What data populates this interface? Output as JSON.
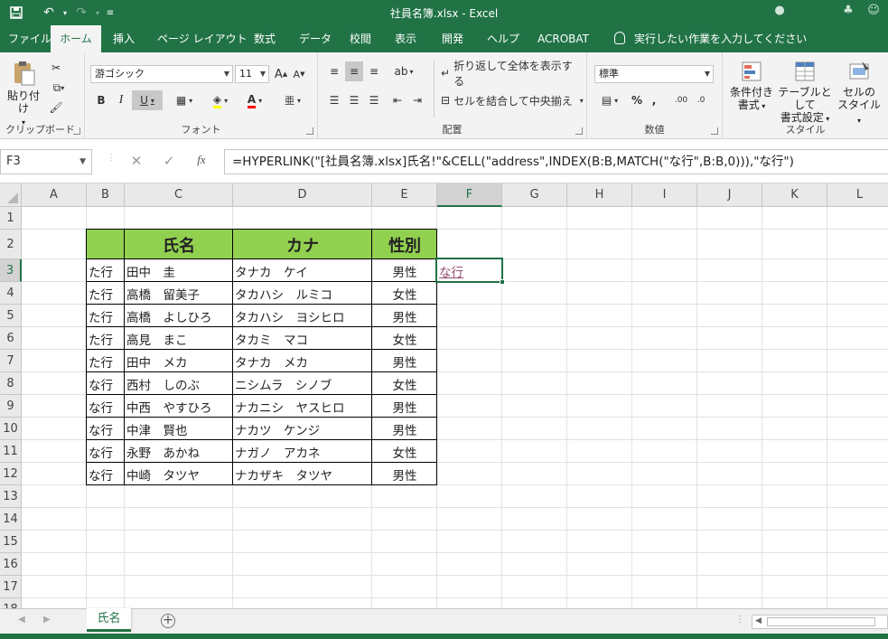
{
  "window": {
    "title": "社員名簿.xlsx  -  Excel"
  },
  "ribbon_tabs": [
    "ファイル",
    "ホーム",
    "挿入",
    "ページ レイアウト",
    "数式",
    "データ",
    "校閲",
    "表示",
    "開発",
    "ヘルプ",
    "ACROBAT"
  ],
  "tell_me": "実行したい作業を入力してください",
  "ribbon": {
    "clipboard": {
      "label": "クリップボード",
      "paste": "貼り付け"
    },
    "font": {
      "label": "フォント",
      "font_name": "游ゴシック",
      "font_size": "11"
    },
    "alignment": {
      "label": "配置",
      "wrap_text": "折り返して全体を表示する",
      "merge_center": "セルを結合して中央揃え"
    },
    "number": {
      "label": "数値",
      "format": "標準"
    },
    "styles": {
      "label": "スタイル",
      "conditional_1": "条件付き",
      "conditional_2": "書式",
      "table_1": "テーブルとして",
      "table_2": "書式設定",
      "cell_1": "セルの",
      "cell_2": "スタイル"
    }
  },
  "formula_bar": {
    "name_box": "F3",
    "fx": "fx",
    "formula": "=HYPERLINK(\"[社員名簿.xlsx]氏名!\"&CELL(\"address\",INDEX(B:B,MATCH(\"な行\",B:B,0))),\"な行\")"
  },
  "columns": [
    "A",
    "B",
    "C",
    "D",
    "E",
    "F",
    "G",
    "H",
    "I",
    "J",
    "K",
    "L"
  ],
  "rows": [
    "1",
    "2",
    "3",
    "4",
    "5",
    "6",
    "7",
    "8",
    "9",
    "10",
    "11",
    "12",
    "13",
    "14",
    "15",
    "16",
    "17",
    "18"
  ],
  "selected": {
    "column": "F",
    "row": "3"
  },
  "table": {
    "headers": [
      "",
      "氏名",
      "カナ",
      "性別"
    ],
    "rows": [
      [
        "た行",
        "田中　圭",
        "タナカ　ケイ",
        "男性"
      ],
      [
        "た行",
        "高橋　留美子",
        "タカハシ　ルミコ",
        "女性"
      ],
      [
        "た行",
        "高橋　よしひろ",
        "タカハシ　ヨシヒロ",
        "男性"
      ],
      [
        "た行",
        "高見　まこ",
        "タカミ　マコ",
        "女性"
      ],
      [
        "た行",
        "田中　メカ",
        "タナカ　メカ",
        "男性"
      ],
      [
        "な行",
        "西村　しのぶ",
        "ニシムラ　シノブ",
        "女性"
      ],
      [
        "な行",
        "中西　やすひろ",
        "ナカニシ　ヤスヒロ",
        "男性"
      ],
      [
        "な行",
        "中津　賢也",
        "ナカツ　ケンジ",
        "男性"
      ],
      [
        "な行",
        "永野　あかね",
        "ナガノ　アカネ",
        "女性"
      ],
      [
        "な行",
        "中崎　タツヤ",
        "ナカザキ　タツヤ",
        "男性"
      ]
    ]
  },
  "link_cell": {
    "text": "な行",
    "color": "#954f72"
  },
  "colors": {
    "excel_green": "#217346",
    "header_fill": "#92d050"
  },
  "sheet_tabs": [
    "氏名"
  ]
}
